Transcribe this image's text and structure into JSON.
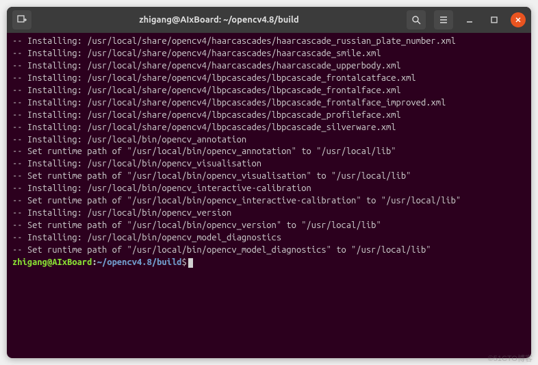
{
  "window": {
    "title": "zhigang@AIxBoard: ~/opencv4.8/build"
  },
  "prompt": {
    "user_host": "zhigang@AIxBoard",
    "path": "~/opencv4.8/build",
    "symbol": "$"
  },
  "output_lines": [
    "-- Installing: /usr/local/share/opencv4/haarcascades/haarcascade_russian_plate_number.xml",
    "-- Installing: /usr/local/share/opencv4/haarcascades/haarcascade_smile.xml",
    "-- Installing: /usr/local/share/opencv4/haarcascades/haarcascade_upperbody.xml",
    "-- Installing: /usr/local/share/opencv4/lbpcascades/lbpcascade_frontalcatface.xml",
    "-- Installing: /usr/local/share/opencv4/lbpcascades/lbpcascade_frontalface.xml",
    "-- Installing: /usr/local/share/opencv4/lbpcascades/lbpcascade_frontalface_improved.xml",
    "-- Installing: /usr/local/share/opencv4/lbpcascades/lbpcascade_profileface.xml",
    "-- Installing: /usr/local/share/opencv4/lbpcascades/lbpcascade_silverware.xml",
    "-- Installing: /usr/local/bin/opencv_annotation",
    "-- Set runtime path of \"/usr/local/bin/opencv_annotation\" to \"/usr/local/lib\"",
    "-- Installing: /usr/local/bin/opencv_visualisation",
    "-- Set runtime path of \"/usr/local/bin/opencv_visualisation\" to \"/usr/local/lib\"",
    "-- Installing: /usr/local/bin/opencv_interactive-calibration",
    "-- Set runtime path of \"/usr/local/bin/opencv_interactive-calibration\" to \"/usr/local/lib\"",
    "-- Installing: /usr/local/bin/opencv_version",
    "-- Set runtime path of \"/usr/local/bin/opencv_version\" to \"/usr/local/lib\"",
    "-- Installing: /usr/local/bin/opencv_model_diagnostics",
    "-- Set runtime path of \"/usr/local/bin/opencv_model_diagnostics\" to \"/usr/local/lib\""
  ],
  "watermark": "©51CTO博客"
}
